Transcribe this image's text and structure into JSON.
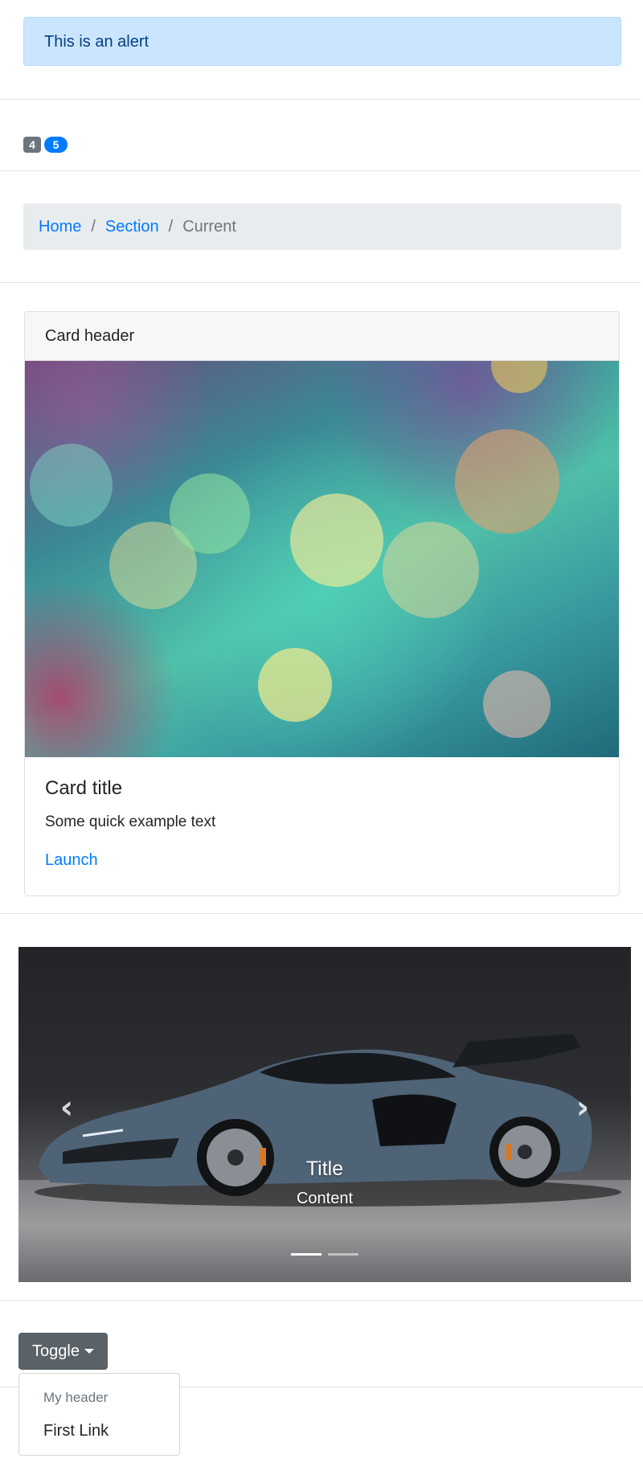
{
  "alert": {
    "text": "This is an alert"
  },
  "badges": [
    {
      "text": "4",
      "color": "#6c757d"
    },
    {
      "text": "5",
      "color": "#007bff"
    }
  ],
  "breadcrumb": {
    "items": [
      {
        "label": "Home",
        "active": false
      },
      {
        "label": "Section",
        "active": false
      },
      {
        "label": "Current",
        "active": true
      }
    ],
    "separator": "/"
  },
  "card": {
    "header": "Card header",
    "image": "bokeh-lights-image",
    "title": "Card title",
    "text": "Some quick example text",
    "link": "Launch"
  },
  "carousel": {
    "image": "sports-car-image",
    "caption_title": "Title",
    "caption_text": "Content",
    "prev_icon": "chevron-left-icon",
    "next_icon": "chevron-right-icon",
    "slides": 2,
    "active_slide": 1
  },
  "dropdown": {
    "toggle_label": "Toggle",
    "menu_header": "My header",
    "items": [
      "First Link"
    ]
  },
  "colors": {
    "primary": "#007bff",
    "secondary": "#6c757d",
    "alert_bg": "#cce5ff",
    "alert_text": "#004085"
  }
}
